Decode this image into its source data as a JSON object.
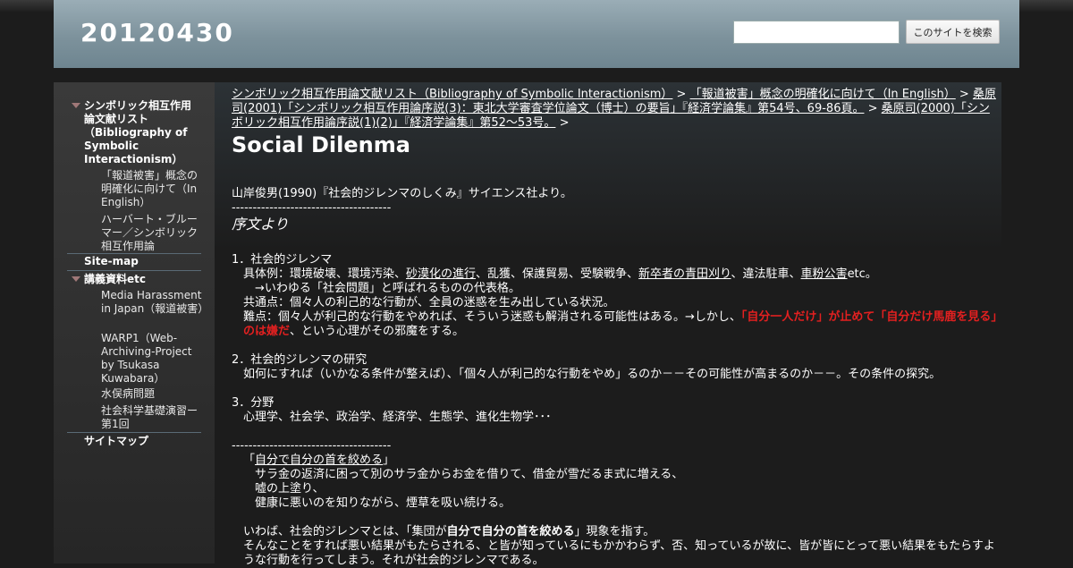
{
  "header": {
    "site_title": "20120430",
    "search_placeholder": "",
    "search_button": "このサイトを検索"
  },
  "sidebar": {
    "items": [
      {
        "label": "シンボリック相互作用論文献リスト（Bibliography of Symbolic Interactionism）"
      },
      {
        "label": "「報道被害」概念の明確化に向けて（In English）"
      },
      {
        "label": "ハーバート・ブルーマー／シンボリック相互作用論"
      },
      {
        "label": "Site-map"
      },
      {
        "label": "講義資料etc"
      },
      {
        "label": "Media Harassment in Japan（報道被害）"
      },
      {
        "label": "WARP1（Web-Archiving-Project by Tsukasa Kuwabara）"
      },
      {
        "label": "水俣病問題"
      },
      {
        "label": "社会科学基礎演習ー第1回"
      },
      {
        "label": "サイトマップ"
      }
    ]
  },
  "breadcrumb": {
    "link1": "シンボリック相互作用論文献リスト（Bibliography of Symbolic Interactionism）",
    "link2": "「報道被害」概念の明確化に向けて（In English）",
    "link3": "桑原司(2001)「シンボリック相互作用論序説(3)：東北大学審査学位論文（博士）の要旨」『経済学論集』第54号、69-86頁。",
    "link4": "桑原司(2000)「シンボリック相互作用論序説(1)(2)」『経済学論集』第52～53号。",
    "sep": ">"
  },
  "page": {
    "title": "Social Dilenma",
    "source": "山岸俊男(1990)『社会的ジレンマのしくみ』サイエンス社より。",
    "rule": "--------------------------------------",
    "preface": "序文より",
    "s1_title": "1．社会的ジレンマ",
    "s1_ex_a": "具体例：環境破壊、環境汚染、",
    "s1_ex_link1": "砂漠化の進行",
    "s1_ex_b": "、乱獲、保護貿易、受験戦争、",
    "s1_ex_link2": "新卒者の青田刈り",
    "s1_ex_c": "、違法駐車、",
    "s1_ex_link3": "車粉公害",
    "s1_ex_d": "etc。",
    "s1_arrow": "→いわゆる「社会問題」と呼ばれるものの代表格。",
    "s1_common": "共通点：個々人の利己的な行動が、全員の迷惑を生み出している状況。",
    "s1_diff_a": "難点：個々人が利己的な行動をやめれば、そういう迷惑も解消される可能性はある。→しかし、",
    "s1_diff_red": "「自分一人だけ」が止めて「自分だけ馬鹿を見る」のは嫌だ",
    "s1_diff_b": "、という心理がその邪魔をする。",
    "s2_title": "2．社会的ジレンマの研究",
    "s2_body": "如何にすれば（いかなる条件が整えば）、「個々人が利己的な行動をやめ」るのか－－その可能性が高まるのか－－。その条件の探究。",
    "s3_title": "3．分野",
    "s3_body": "心理学、社会学、政治学、経済学、生態学、進化生物学･･･",
    "q_open": "「",
    "q_link": "自分で自分の首を絞める",
    "q_close": "」",
    "q_line1": "サラ金の返済に困って別のサラ金からお金を借りて、借金が雪だるま式に増える、",
    "q_line2": "嘘の上塗り、",
    "q_line3": "健康に悪いのを知りながら、煙草を吸い続ける。",
    "p1_a": "いわば、社会的ジレンマとは、「集団が",
    "p1_bold": "自分で自分の首を絞める",
    "p1_b": "」現象を指す。",
    "p2": "そんなことをすれば悪い結果がもたらされる、と皆が知っているにもかかわらず、否、知っているが故に、皆が皆にとって悪い結果をもたらすような行動を行ってしまう。それが社会的ジレンマである。"
  },
  "colors": {
    "background": "#1c1c1c",
    "header": "#8a9ea8",
    "emphasis_red": "#e32020",
    "toggle_triangle": "#a07878"
  }
}
